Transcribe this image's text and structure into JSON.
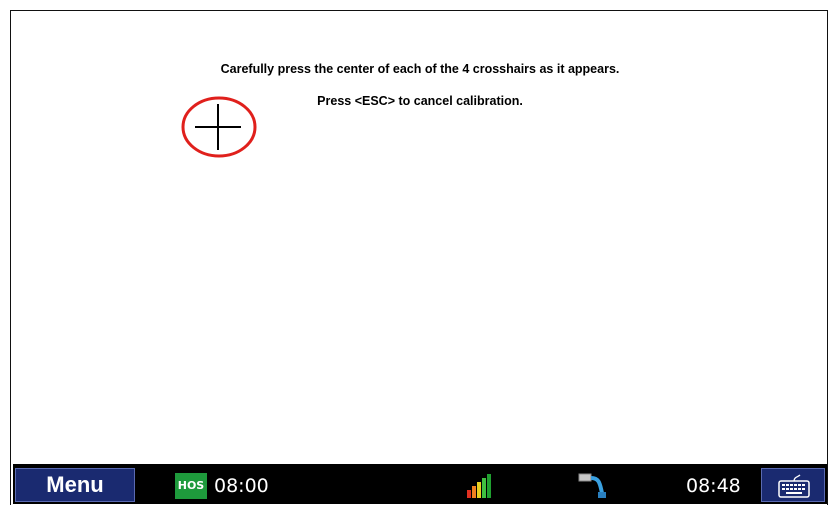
{
  "calibration": {
    "instruction_line1": "Carefully press the center of each of the 4 crosshairs as it appears.",
    "instruction_line2": "Press <ESC> to cancel calibration.",
    "target_icon": "crosshair-icon",
    "highlight_color": "#e0201c"
  },
  "taskbar": {
    "menu_label": "Menu",
    "hos_badge": "HOS",
    "hos_time": "08:00",
    "signal_icon": "signal-strength-icon",
    "connection_icon": "cable-connection-icon",
    "clock": "08:48",
    "keyboard_icon": "keyboard-icon",
    "colors": {
      "bar": "#000000",
      "button": "#1a2a70",
      "hos_green": "#1e9a3c"
    }
  }
}
